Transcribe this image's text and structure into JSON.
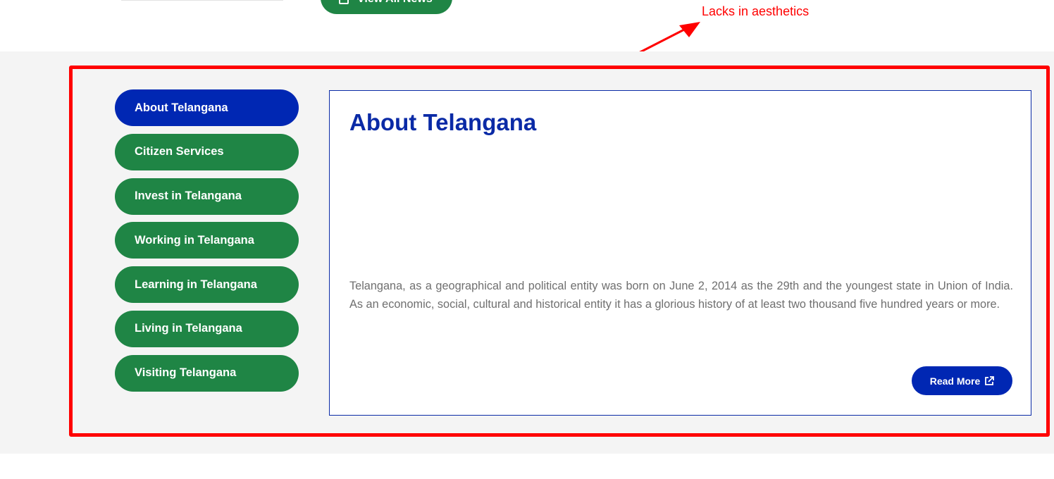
{
  "header": {
    "view_all_label": "View All News"
  },
  "annotation": {
    "text": "Lacks in aesthetics",
    "color": "#ff0000"
  },
  "sidebar": {
    "items": [
      {
        "label": "About Telangana",
        "active": true
      },
      {
        "label": "Citizen Services",
        "active": false
      },
      {
        "label": "Invest in Telangana",
        "active": false
      },
      {
        "label": "Working in Telangana",
        "active": false
      },
      {
        "label": "Learning in Telangana",
        "active": false
      },
      {
        "label": "Living in Telangana",
        "active": false
      },
      {
        "label": "Visiting Telangana",
        "active": false
      }
    ]
  },
  "content": {
    "title": "About Telangana",
    "body": "Telangana, as a geographical and political entity was born on June 2, 2014 as the 29th and the youngest state in Union of India. As an economic, social, cultural and historical entity it has a glorious history of at least two thousand five hundred years or more.",
    "read_more_label": "Read More"
  },
  "colors": {
    "active_blue": "#0027b3",
    "green": "#1f8545",
    "section_bg": "#f4f4f4",
    "text_grey": "#6f6f6f",
    "icons": [
      "news-icon",
      "external-link-icon",
      "annotation-arrow"
    ]
  }
}
